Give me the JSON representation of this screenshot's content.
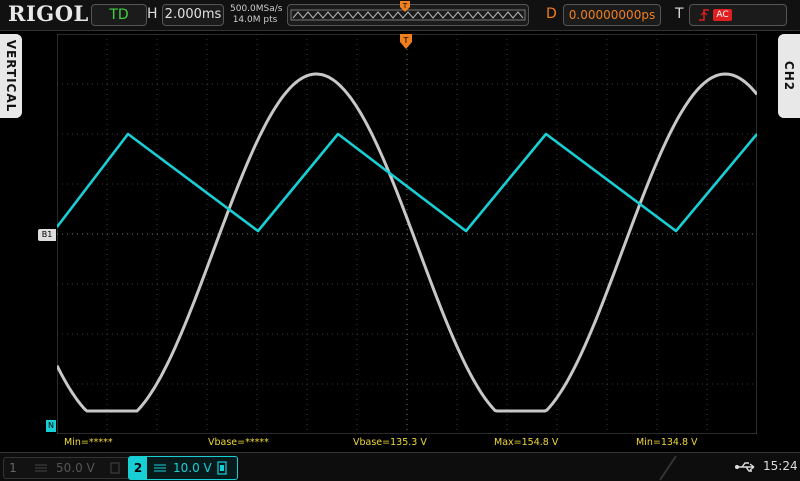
{
  "header": {
    "logo": "RIGOL",
    "run_status": "TD",
    "horizontal_label": "H",
    "timebase": "2.000ms",
    "sample_rate": "500.0MSa/s",
    "memory_depth": "14.0M pts",
    "delay_label": "D",
    "delay_value": "0.00000000ps",
    "trigger_label": "T",
    "trigger_coupling": "AC"
  },
  "side": {
    "left_tab": "VERTICAL",
    "right_tab": "CH2"
  },
  "markers": {
    "trigger_position": "T",
    "ch2_reference": "B1",
    "ch1_reference": "N"
  },
  "measurements": [
    {
      "text": "Min=*****"
    },
    {
      "text": "Vbase=*****"
    },
    {
      "text": "Vbase=135.3 V"
    },
    {
      "text": "Max=154.8 V"
    },
    {
      "text": "Min=134.8 V"
    }
  ],
  "channels": {
    "ch1": {
      "number": "1",
      "scale": "50.0 V"
    },
    "ch2": {
      "number": "2",
      "scale": "10.0 V"
    }
  },
  "status": {
    "clock": "15:24"
  },
  "colors": {
    "ch1_trace": "#c8c8c8",
    "ch2_trace": "#19cfd6",
    "measurement_text": "#f0d838",
    "trigger_accent": "#f07f1e"
  },
  "icons": [
    "stop-icon",
    "trigger-edge-icon",
    "usb-icon",
    "probe-icon"
  ]
}
